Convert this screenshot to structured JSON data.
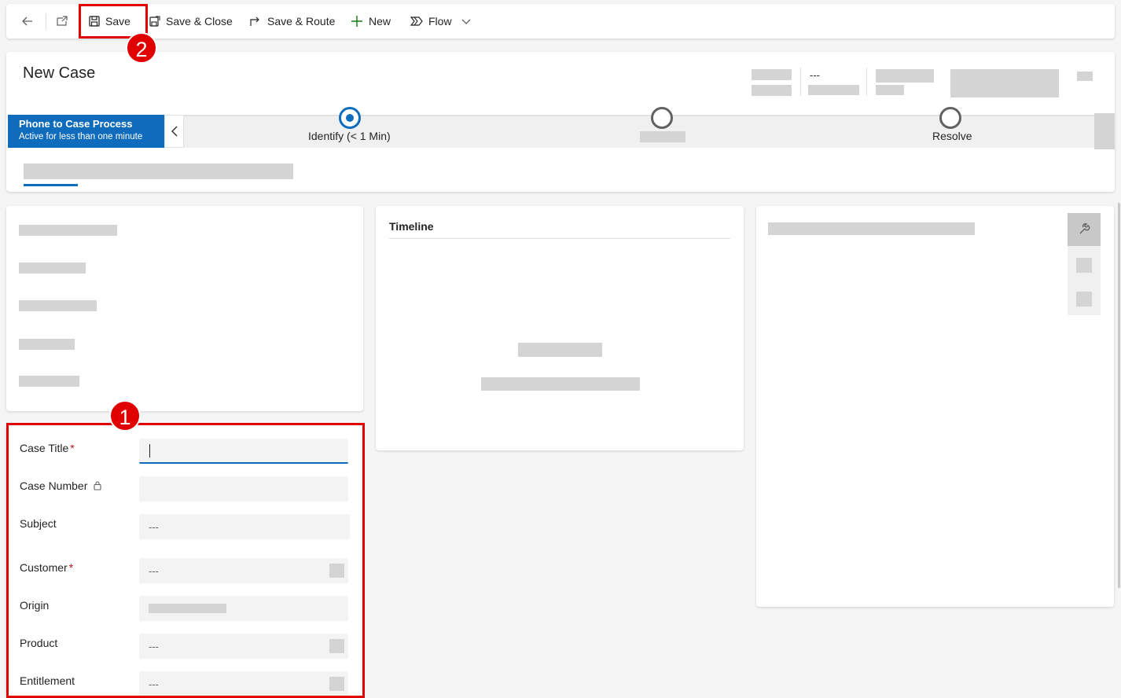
{
  "toolbar": {
    "save": "Save",
    "save_close": "Save & Close",
    "save_route": "Save & Route",
    "new": "New",
    "flow": "Flow"
  },
  "callouts": {
    "one": "1",
    "two": "2"
  },
  "header": {
    "title": "New Case",
    "dash": "---"
  },
  "bpf": {
    "process_name": "Phone to Case Process",
    "process_status": "Active for less than one minute",
    "stages": [
      {
        "label": "Identify  (< 1 Min)",
        "active": true
      },
      {
        "label": "",
        "active": false
      },
      {
        "label": "Resolve",
        "active": false
      }
    ]
  },
  "timeline": {
    "title": "Timeline"
  },
  "form": {
    "fields": [
      {
        "label": "Case Title",
        "required": true,
        "value": ""
      },
      {
        "label": "Case Number",
        "locked": true,
        "value": ""
      },
      {
        "label": "Subject",
        "value": "---"
      },
      {
        "label": "Customer",
        "required": true,
        "value": "---"
      },
      {
        "label": "Origin",
        "value": ""
      },
      {
        "label": "Product",
        "value": "---"
      },
      {
        "label": "Entitlement",
        "value": "---"
      }
    ],
    "required_mark": "*"
  },
  "colors": {
    "accent": "#0f6cbd",
    "callout": "#e00000"
  }
}
